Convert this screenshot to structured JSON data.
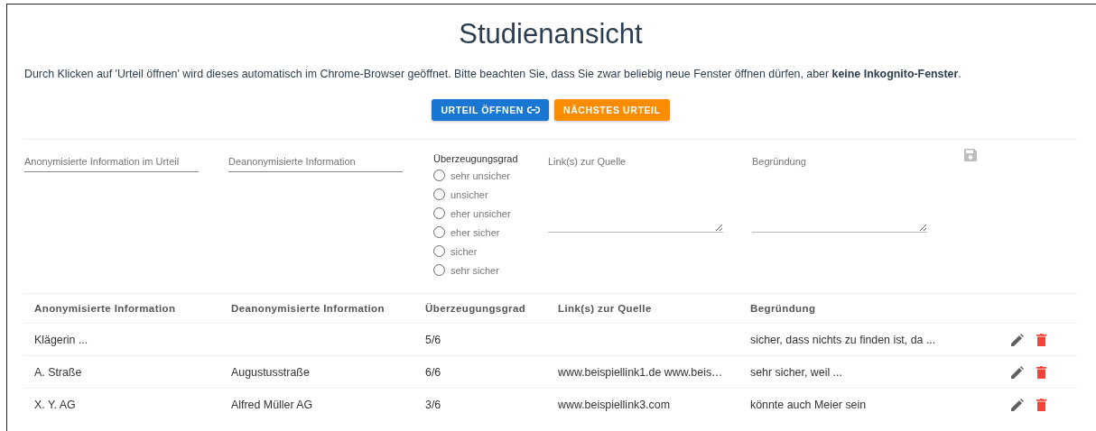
{
  "title": "Studienansicht",
  "notice": "Durch Klicken auf 'Urteil öffnen' wird dieses automatisch im Chrome-Browser geöffnet. Bitte beachten Sie, dass Sie zwar beliebig neue Fenster öffnen dürfen, aber **keine Inkognito-Fenster**.",
  "buttons": [
    {
      "label": "URTEIL ÖFFNEN",
      "kind": "primary"
    },
    {
      "label": "NÄCHSTES URTEIL",
      "kind": "accent"
    }
  ],
  "form": {
    "fields": [
      {
        "kind": "line",
        "placeholder": "Anonymisierte Information im Urteil"
      },
      {
        "kind": "line",
        "placeholder": "Deanonymisierte Information"
      },
      {
        "kind": "radio",
        "label": "Überzeugungsgrad",
        "options": [
          {
            "label": "sehr unsicher",
            "selected": false
          },
          {
            "label": "unsicher",
            "selected": false
          },
          {
            "label": "eher unsicher",
            "selected": false
          },
          {
            "label": "eher sicher",
            "selected": false
          },
          {
            "label": "sicher",
            "selected": false
          },
          {
            "label": "sehr sicher",
            "selected": false
          }
        ]
      },
      {
        "kind": "area",
        "placeholder": "Link(s) zur Quelle"
      },
      {
        "kind": "area",
        "placeholder": "Begründung"
      }
    ],
    "save_disabled": true
  },
  "table": {
    "columns": [
      "Anonymisierte Information",
      "Deanonymisierte Information",
      "Überzeugungsgrad",
      "Link(s) zur Quelle",
      "Begründung"
    ],
    "rows": [
      {
        "cells": [
          "Klägerin ...",
          "",
          "5/6",
          "",
          "sicher, dass nichts zu finden ist, da ..."
        ]
      },
      {
        "cells": [
          "A. Straße",
          "Augustusstraße",
          "6/6",
          "www.beispiellink1.de www.beis…",
          "sehr sicher, weil ..."
        ]
      },
      {
        "cells": [
          "X. Y. AG",
          "Alfred Müller AG",
          "3/6",
          "www.beispiellink3.com",
          "könnte auch Meier sein"
        ]
      }
    ]
  }
}
